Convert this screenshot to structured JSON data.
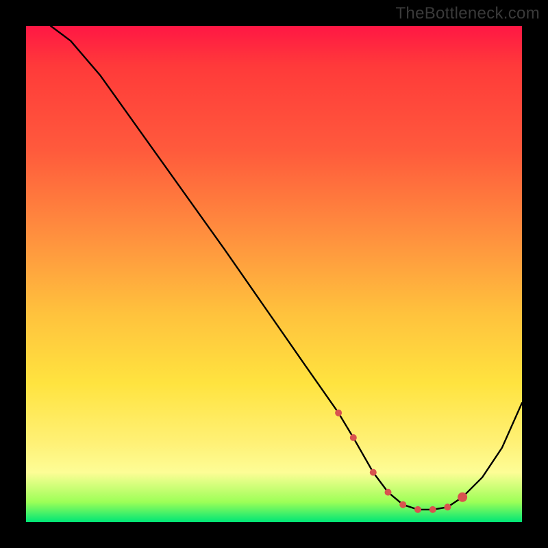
{
  "watermark": "TheBottleneck.com",
  "chart_data": {
    "type": "line",
    "title": "",
    "xlabel": "",
    "ylabel": "",
    "xlim": [
      0,
      100
    ],
    "ylim": [
      0,
      100
    ],
    "series": [
      {
        "name": "curve",
        "color": "#000000",
        "x": [
          5,
          9,
          15,
          25,
          40,
          56,
          63,
          66,
          70,
          73,
          76,
          79,
          82,
          85,
          88,
          92,
          96,
          100
        ],
        "values": [
          100,
          97,
          90,
          76,
          55,
          32,
          22,
          17,
          10,
          6,
          3.5,
          2.5,
          2.5,
          3,
          5,
          9,
          15,
          24
        ]
      }
    ],
    "markers": {
      "name": "bottleneck-dots",
      "color": "#d9534f",
      "radius_small": 5,
      "radius_large": 7,
      "x": [
        63,
        66,
        70,
        73,
        76,
        79,
        82,
        85,
        88
      ],
      "values": [
        22,
        17,
        10,
        6,
        3.5,
        2.5,
        2.5,
        3,
        5
      ]
    }
  }
}
